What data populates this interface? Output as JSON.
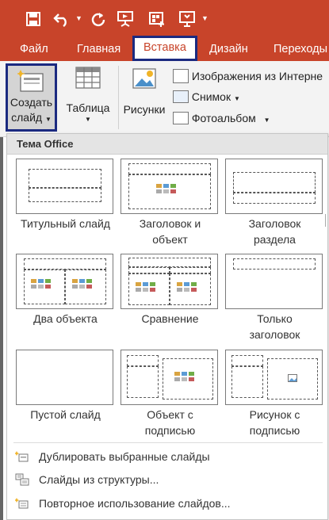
{
  "quick_access": {
    "icons": [
      "save-icon",
      "undo-icon",
      "undo-dropdown-icon",
      "redo-icon",
      "present-from-start-icon",
      "new-presentation-icon",
      "screen-presentation-icon"
    ]
  },
  "tabs": [
    {
      "label": "Файл"
    },
    {
      "label": "Главная"
    },
    {
      "label": "Вставка"
    },
    {
      "label": "Дизайн"
    },
    {
      "label": "Переходы"
    }
  ],
  "ribbon": {
    "new_slide": {
      "line1": "Создать",
      "line2": "слайд"
    },
    "table": {
      "label": "Таблица"
    },
    "pictures": {
      "label": "Рисунки"
    },
    "images_online": {
      "label": "Изображения из Интерне"
    },
    "screenshot": {
      "label": "Снимок"
    },
    "photo_album": {
      "label": "Фотоальбом"
    }
  },
  "gallery": {
    "header": "Тема Office",
    "layouts": [
      {
        "name": "title-slide",
        "line1": "Титульный слайд",
        "line2": ""
      },
      {
        "name": "title-and-content",
        "line1": "Заголовок и",
        "line2": "объект"
      },
      {
        "name": "section-header",
        "line1": "Заголовок",
        "line2": "раздела"
      },
      {
        "name": "two-content",
        "line1": "Два объекта",
        "line2": ""
      },
      {
        "name": "comparison",
        "line1": "Сравнение",
        "line2": ""
      },
      {
        "name": "title-only",
        "line1": "Только",
        "line2": "заголовок"
      },
      {
        "name": "blank",
        "line1": "Пустой слайд",
        "line2": ""
      },
      {
        "name": "content-with-caption",
        "line1": "Объект с",
        "line2": "подписью"
      },
      {
        "name": "picture-with-caption",
        "line1": "Рисунок с",
        "line2": "подписью"
      }
    ],
    "commands": [
      {
        "label": "Дублировать выбранные слайды"
      },
      {
        "label": "Слайды из структуры..."
      },
      {
        "label": "Повторное использование слайдов..."
      }
    ]
  },
  "colors": {
    "accent": "#c8442a",
    "highlight_border": "#1b2a80",
    "ribbon_bg": "#f3f3f3"
  }
}
